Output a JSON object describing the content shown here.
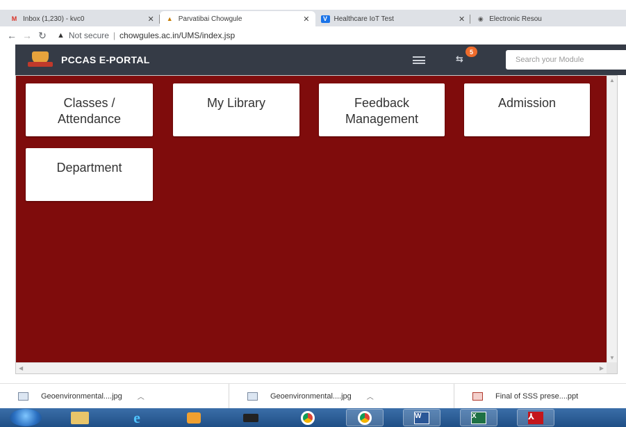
{
  "browser": {
    "tabs": [
      {
        "favicon": "gmail-icon",
        "title": "Inbox (1,230) - kvc0",
        "active": false
      },
      {
        "favicon": "college-crest-icon",
        "title": "Parvatibai Chowgule",
        "active": true
      },
      {
        "favicon": "v-logo-icon",
        "title": "Healthcare IoT Test",
        "active": false
      },
      {
        "favicon": "globe-icon",
        "title": "Electronic Resou",
        "active": false
      }
    ],
    "security_label": "Not secure",
    "url": "chowgules.ac.in/UMS/index.jsp"
  },
  "portal": {
    "brand": "PCCAS E-PORTAL",
    "notification_count": "5",
    "search_placeholder": "Search your Module"
  },
  "modules": [
    {
      "line1": "Classes /",
      "line2": "Attendance"
    },
    {
      "line1": "My Library",
      "line2": ""
    },
    {
      "line1": "Feedback",
      "line2": "Management"
    },
    {
      "line1": "Admission",
      "line2": ""
    },
    {
      "line1": "Department",
      "line2": ""
    }
  ],
  "downloads": [
    {
      "name": "Geoenvironmental....jpg",
      "type": "image"
    },
    {
      "name": "Geoenvironmental....jpg",
      "type": "image"
    },
    {
      "name": "Final of SSS prese....ppt",
      "type": "ppt"
    }
  ],
  "taskbar": {
    "items": [
      "start-orb-icon",
      "file-explorer-icon",
      "internet-explorer-icon",
      "media-player-icon",
      "camera-app-icon",
      "chrome-icon",
      "word-icon",
      "excel-icon",
      "acrobat-icon"
    ]
  },
  "colors": {
    "content_bg": "#7f0c0c",
    "header_bg": "#353b46",
    "card_bg": "#ffffff",
    "badge": "#ef6c2c"
  }
}
